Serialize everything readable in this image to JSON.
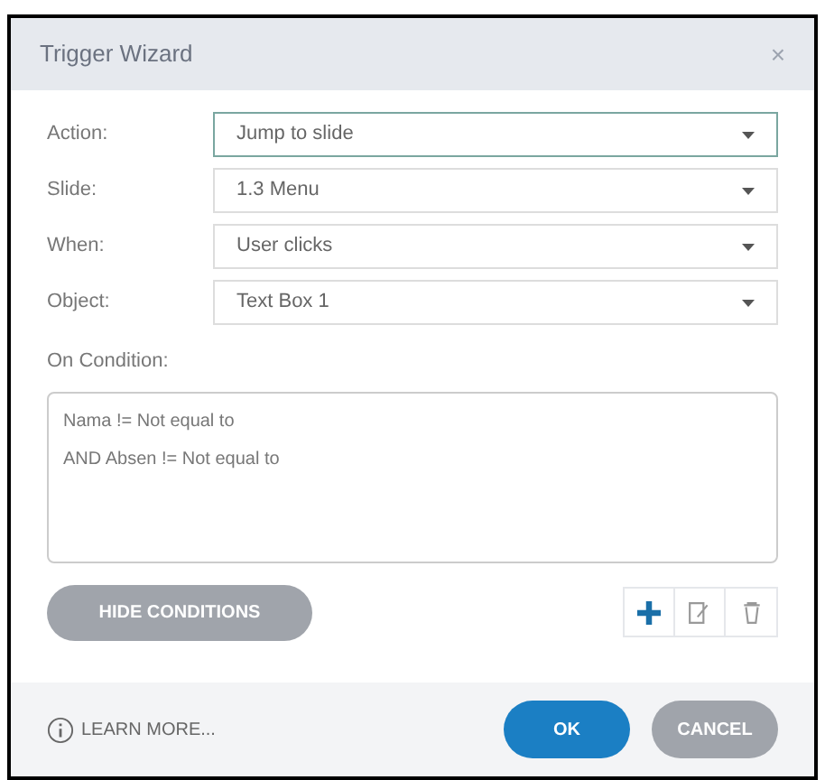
{
  "window": {
    "title": "Trigger Wizard",
    "close": "×"
  },
  "fields": [
    {
      "label": "Action:",
      "value": "Jump to slide",
      "focused": true
    },
    {
      "label": "Slide:",
      "value": "1.3 Menu",
      "focused": false
    },
    {
      "label": "When:",
      "value": "User clicks",
      "focused": false
    },
    {
      "label": "Object:",
      "value": "Text Box 1",
      "focused": false
    }
  ],
  "condition": {
    "label": "On Condition:",
    "lines": [
      "Nama != Not equal to",
      "AND Absen != Not equal to"
    ]
  },
  "hide_conditions": "HIDE CONDITIONS",
  "footer": {
    "learn_more": "LEARN MORE...",
    "ok": "OK",
    "cancel": "CANCEL"
  }
}
